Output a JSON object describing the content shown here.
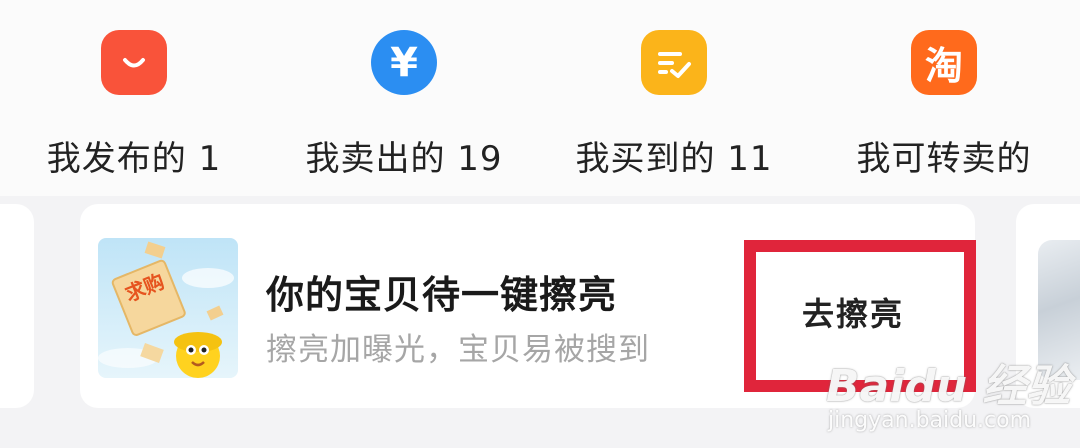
{
  "shortcuts": [
    {
      "label": "我发布的 1",
      "icon": "shopping-bag-icon",
      "color": "#f9533a"
    },
    {
      "label": "我卖出的 19",
      "icon": "yen-coin-icon",
      "color": "#2b8ef2"
    },
    {
      "label": "我买到的 11",
      "icon": "checklist-icon",
      "color": "#fbb41a"
    },
    {
      "label": "我可转卖的",
      "icon": "taobao-icon",
      "color": "#ff6a1c",
      "glyph": "淘"
    }
  ],
  "card": {
    "title": "你的宝贝待一键擦亮",
    "subtitle": "擦亮加曝光，宝贝易被搜到",
    "button_label": "去擦亮",
    "image_text": "求购",
    "highlight_color": "#e0253b"
  },
  "yen_symbol": "¥",
  "watermark": {
    "brand": "Baidu 经验",
    "url": "jingyan.baidu.com"
  }
}
